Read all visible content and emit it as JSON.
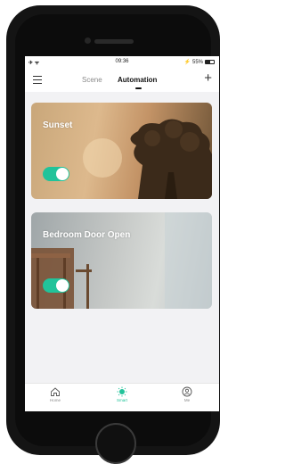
{
  "status_bar": {
    "time": "09:36",
    "battery": "55%"
  },
  "header": {
    "tabs": [
      {
        "label": "Scene",
        "active": false
      },
      {
        "label": "Automation",
        "active": true
      }
    ]
  },
  "automations": [
    {
      "name": "Sunset",
      "enabled": true
    },
    {
      "name": "Bedroom Door Open",
      "enabled": true
    }
  ],
  "tab_bar": {
    "items": [
      {
        "label": "Home",
        "icon": "home-icon",
        "active": false
      },
      {
        "label": "Smart",
        "icon": "smart-sun-icon",
        "active": true
      },
      {
        "label": "Me",
        "icon": "profile-icon",
        "active": false
      }
    ]
  },
  "colors": {
    "accent": "#21c39a",
    "background": "#f2f2f4"
  }
}
